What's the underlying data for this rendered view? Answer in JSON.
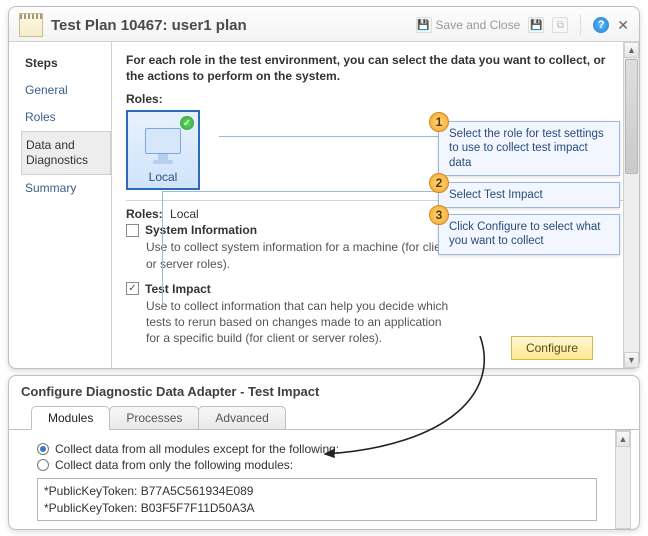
{
  "titlebar": {
    "title": "Test Plan 10467: user1 plan",
    "save_close_label": "Save and Close"
  },
  "sidebar": {
    "heading": "Steps",
    "items": [
      {
        "label": "General"
      },
      {
        "label": "Roles"
      },
      {
        "label": "Data and Diagnostics"
      },
      {
        "label": "Summary"
      }
    ]
  },
  "content": {
    "intro": "For each role in the test environment, you can select the data you want to collect, or the actions to perform on the system.",
    "roles_label": "Roles:",
    "role_tile_caption": "Local",
    "selected_role_label": "Roles:",
    "selected_role_value": "Local",
    "adapters": [
      {
        "checked": false,
        "name": "System Information",
        "desc": "Use to collect system information for a machine (for client or server roles)."
      },
      {
        "checked": true,
        "name": "Test Impact",
        "desc": "Use to collect information that can help you decide which tests to rerun based on changes made to an application for a specific build (for client or server roles)."
      }
    ],
    "configure_label": "Configure"
  },
  "callouts": {
    "c1": {
      "num": "1",
      "text": "Select the role for test settings to use to collect test impact data"
    },
    "c2": {
      "num": "2",
      "text": "Select Test Impact"
    },
    "c3": {
      "num": "3",
      "text": "Click Configure to select what you want to collect"
    }
  },
  "panel2": {
    "title": "Configure Diagnostic Data Adapter - Test Impact",
    "tabs": [
      {
        "label": "Modules"
      },
      {
        "label": "Processes"
      },
      {
        "label": "Advanced"
      }
    ],
    "radio_all": "Collect data from all modules except for the following:",
    "radio_only": "Collect data from only the following modules:",
    "tokens": [
      "*PublicKeyToken: B77A5C561934E089",
      "*PublicKeyToken: B03F5F7F11D50A3A"
    ]
  }
}
